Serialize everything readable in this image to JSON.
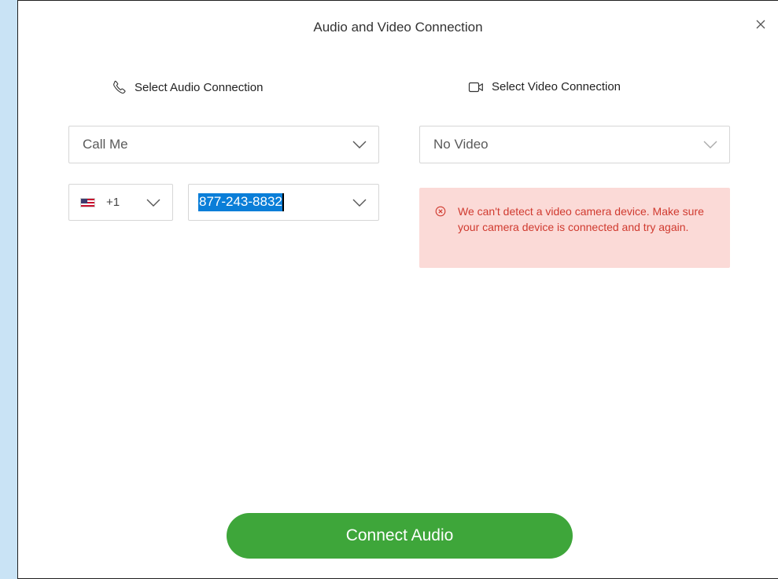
{
  "dialog": {
    "title": "Audio and Video Connection",
    "close_icon": "close-icon"
  },
  "audio": {
    "heading": "Select Audio Connection",
    "heading_icon": "phone-icon",
    "connection_value": "Call Me",
    "country_flag": "us-flag-icon",
    "country_code": "+1",
    "phone_number": "877-243-8832"
  },
  "video": {
    "heading": "Select Video Connection",
    "heading_icon": "video-camera-icon",
    "connection_value": "No Video",
    "error_icon": "error-circle-icon",
    "error_message": "We can't detect a video camera device. Make sure your camera device is connected and try again."
  },
  "footer": {
    "connect_label": "Connect Audio"
  },
  "colors": {
    "accent_green": "#3ea63a",
    "error_bg": "#fbdad7",
    "error_text": "#d03a2f",
    "selection_blue": "#0a7ed8",
    "backdrop": "#c9e3f5"
  }
}
